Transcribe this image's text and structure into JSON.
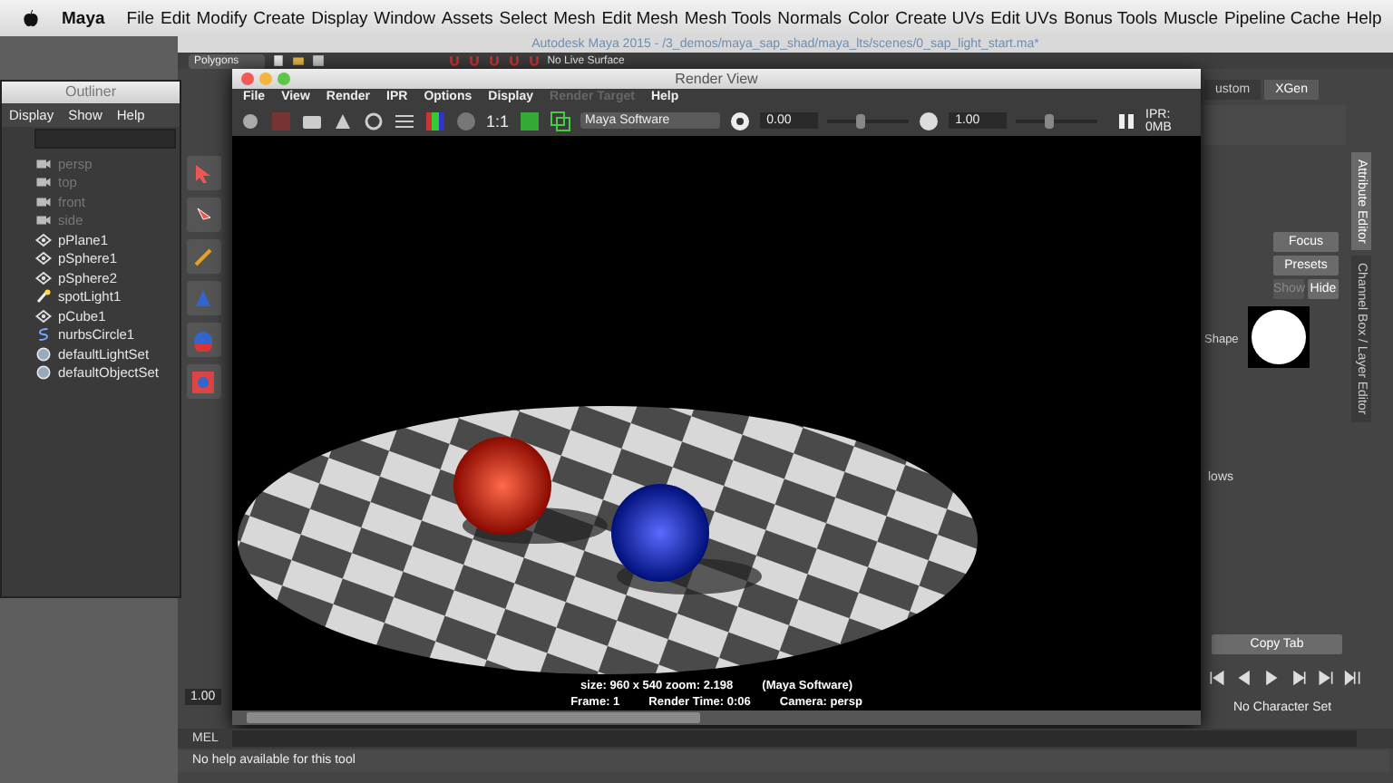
{
  "menubar": {
    "app": "Maya",
    "items": [
      "File",
      "Edit",
      "Modify",
      "Create",
      "Display",
      "Window",
      "Assets",
      "Select",
      "Mesh",
      "Edit Mesh",
      "Mesh Tools",
      "Normals",
      "Color",
      "Create UVs",
      "Edit UVs",
      "Bonus Tools",
      "Muscle",
      "Pipeline Cache",
      "Help"
    ]
  },
  "main_window": {
    "title": "Autodesk Maya 2015 - /3_demos/maya_sap_shad/maya_lts/scenes/0_sap_light_start.ma*",
    "menu_set": "Polygons",
    "live_surface": "No Live Surface"
  },
  "outliner": {
    "title": "Outliner",
    "menus": [
      "Display",
      "Show",
      "Help"
    ],
    "items": [
      {
        "label": "persp",
        "kind": "camera",
        "dimmed": true
      },
      {
        "label": "top",
        "kind": "camera",
        "dimmed": true
      },
      {
        "label": "front",
        "kind": "camera",
        "dimmed": true
      },
      {
        "label": "side",
        "kind": "camera",
        "dimmed": true
      },
      {
        "label": "pPlane1",
        "kind": "mesh",
        "dimmed": false
      },
      {
        "label": "pSphere1",
        "kind": "mesh",
        "dimmed": false
      },
      {
        "label": "pSphere2",
        "kind": "mesh",
        "dimmed": false
      },
      {
        "label": "spotLight1",
        "kind": "light",
        "dimmed": false
      },
      {
        "label": "pCube1",
        "kind": "mesh",
        "dimmed": false
      },
      {
        "label": "nurbsCircle1",
        "kind": "curve",
        "dimmed": false
      },
      {
        "label": "defaultLightSet",
        "kind": "set",
        "dimmed": false
      },
      {
        "label": "defaultObjectSet",
        "kind": "set",
        "dimmed": false
      }
    ]
  },
  "render_view": {
    "title": "Render View",
    "menus": [
      {
        "label": "File",
        "disabled": false
      },
      {
        "label": "View",
        "disabled": false
      },
      {
        "label": "Render",
        "disabled": false
      },
      {
        "label": "IPR",
        "disabled": false
      },
      {
        "label": "Options",
        "disabled": false
      },
      {
        "label": "Display",
        "disabled": false
      },
      {
        "label": "Render Target",
        "disabled": true
      },
      {
        "label": "Help",
        "disabled": false
      }
    ],
    "ratio": "1:1",
    "renderer": "Maya Software",
    "exposure": "0.00",
    "exposure_slider": {
      "level": 0.4
    },
    "gamma": "1.00",
    "gamma_slider": {
      "level": 0.4
    },
    "ipr": "IPR: 0MB",
    "info": [
      [
        "size: 960 x 540 zoom: 2.198",
        "(Maya Software)"
      ],
      [
        "Frame: 1",
        "Render Time: 0:06",
        "Camera: persp"
      ]
    ]
  },
  "attribute_editor": {
    "tabs": [
      {
        "label": "ustom",
        "selected": false
      },
      {
        "label": "XGen",
        "selected": true
      }
    ],
    "buttons": [
      {
        "label": "Focus",
        "disabled": false
      },
      {
        "label": "Presets",
        "disabled": false
      }
    ],
    "visibility": [
      {
        "label": "Show",
        "disabled": true
      },
      {
        "label": "Hide",
        "disabled": false
      }
    ],
    "shape_label": "Shape",
    "section_label": "lows",
    "copy_tab": "Copy Tab",
    "side_tabs": [
      {
        "label": "Attribute Editor",
        "selected": true
      },
      {
        "label": "Channel Box / Layer Editor",
        "selected": false
      }
    ]
  },
  "time_controls": {
    "playback_speed": "1.00",
    "character_set": "No Character Set"
  },
  "command_line": {
    "label": "MEL"
  },
  "help_line": "No help available for this tool"
}
